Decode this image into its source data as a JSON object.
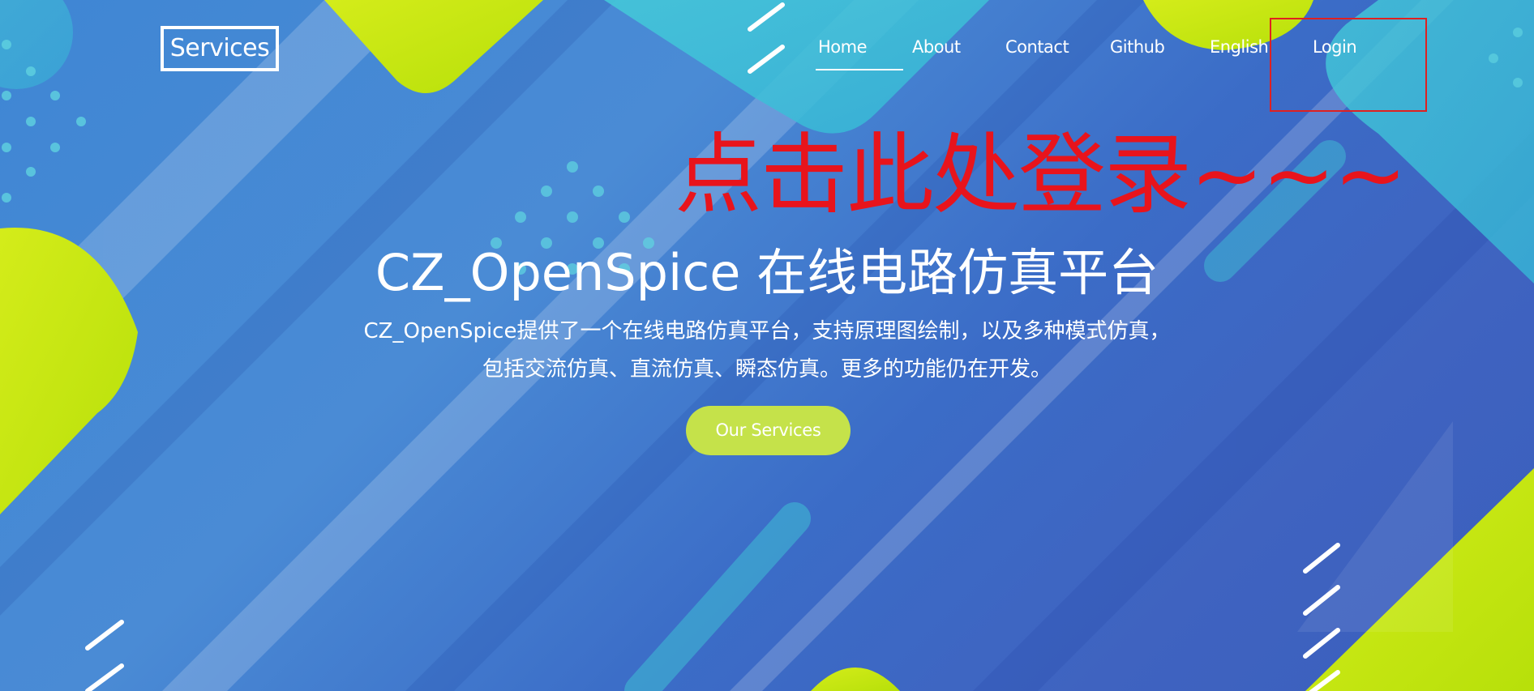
{
  "brand": {
    "logo_text": "Services"
  },
  "nav": {
    "items": [
      {
        "label": "Home",
        "active": true
      },
      {
        "label": "About"
      },
      {
        "label": "Contact"
      },
      {
        "label": "Github"
      },
      {
        "label": "English"
      },
      {
        "label": "Login"
      }
    ]
  },
  "annotation": {
    "text": "点击此处登录~~~",
    "color": "#e8141c"
  },
  "hero": {
    "title": "CZ_OpenSpice 在线电路仿真平台",
    "description": "CZ_OpenSpice提供了一个在线电路仿真平台，支持原理图绘制，以及多种模式仿真，包括交流仿真、直流仿真、瞬态仿真。更多的功能仍在开发。",
    "cta_label": "Our Services"
  },
  "colors": {
    "background_blue": "#3f7fd0",
    "accent_lime": "#c4e80f",
    "accent_cyan": "#3ec9d8",
    "cta_bg": "#c5e24a",
    "highlight_red": "#e02020"
  }
}
